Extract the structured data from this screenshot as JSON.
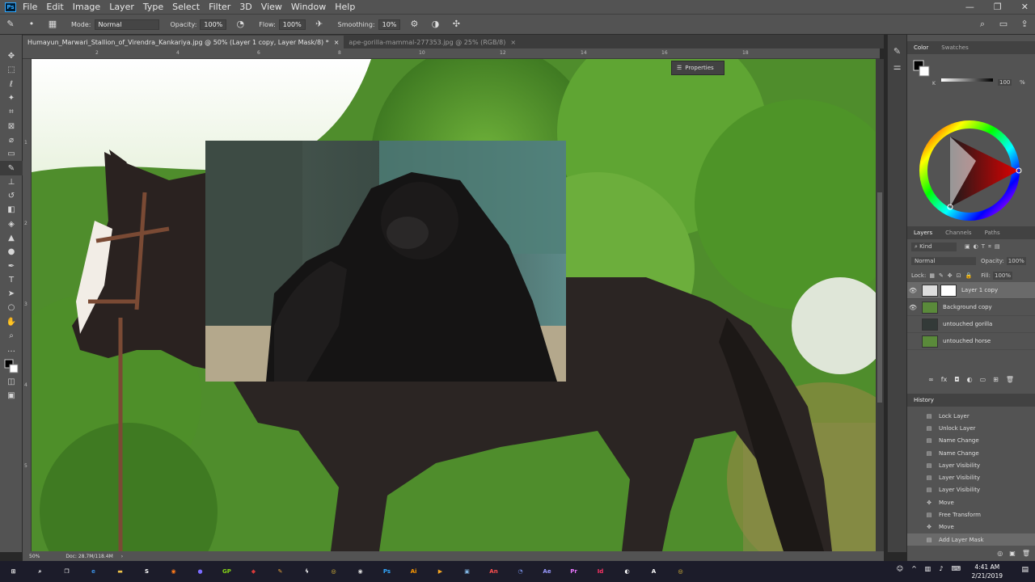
{
  "menubar": {
    "logo": "Ps",
    "items": [
      "File",
      "Edit",
      "Image",
      "Layer",
      "Type",
      "Select",
      "Filter",
      "3D",
      "View",
      "Window",
      "Help"
    ],
    "window_controls": [
      "—",
      "❐",
      "✕"
    ]
  },
  "options": {
    "mode_label": "Mode:",
    "mode_value": "Normal",
    "opacity_label": "Opacity:",
    "opacity_value": "100%",
    "flow_label": "Flow:",
    "flow_value": "100%",
    "smoothing_label": "Smoothing:",
    "smoothing_value": "10%"
  },
  "tabs": [
    {
      "label": "Humayun_Marwari_Stallion_of_Virendra_Kankariya.jpg @ 50% (Layer 1 copy, Layer Mask/8) *",
      "close": "×"
    },
    {
      "label": "ape-gorilla-mammal-277353.jpg @ 25% (RGB/8)",
      "close": "×"
    }
  ],
  "ruler": {
    "h": [
      "0",
      "2",
      "4",
      "6",
      "8",
      "10",
      "12",
      "14",
      "16",
      "18"
    ],
    "v": [
      "0",
      "1",
      "2",
      "3",
      "4",
      "5"
    ]
  },
  "properties": {
    "label": "Properties"
  },
  "status": {
    "zoom": "50%",
    "doc": "Doc: 28.7M/118.4M"
  },
  "color_panel": {
    "tabs": [
      "Color",
      "Swatches"
    ],
    "k_label": "K",
    "k_value": "100",
    "pct": "%"
  },
  "layers_panel": {
    "tabs": [
      "Layers",
      "Channels",
      "Paths"
    ],
    "filter": "Kind",
    "blend": "Normal",
    "opacity_label": "Opacity:",
    "opacity_value": "100%",
    "lock_label": "Lock:",
    "fill_label": "Fill:",
    "fill_value": "100%",
    "layers": [
      {
        "name": "Layer 1 copy",
        "visible": true,
        "selected": true
      },
      {
        "name": "Background copy",
        "visible": true,
        "selected": false
      },
      {
        "name": "untouched gorilla",
        "visible": false,
        "selected": false
      },
      {
        "name": "untouched horse",
        "visible": false,
        "selected": false
      }
    ],
    "footer_icons": [
      "link-icon",
      "fx-icon",
      "mask-icon",
      "adjustment-icon",
      "group-icon",
      "new-layer-icon",
      "trash-icon"
    ]
  },
  "history_panel": {
    "title": "History",
    "items": [
      {
        "label": "Lock Layer",
        "icon": "doc"
      },
      {
        "label": "Unlock Layer",
        "icon": "doc"
      },
      {
        "label": "Name Change",
        "icon": "doc"
      },
      {
        "label": "Name Change",
        "icon": "doc"
      },
      {
        "label": "Layer Visibility",
        "icon": "doc"
      },
      {
        "label": "Layer Visibility",
        "icon": "doc"
      },
      {
        "label": "Layer Visibility",
        "icon": "doc"
      },
      {
        "label": "Move",
        "icon": "move"
      },
      {
        "label": "Free Transform",
        "icon": "doc"
      },
      {
        "label": "Move",
        "icon": "move"
      },
      {
        "label": "Add Layer Mask",
        "icon": "doc",
        "selected": true
      }
    ]
  },
  "taskbar": {
    "clock_time": "4:41 AM",
    "clock_date": "2/21/2019",
    "apps": [
      {
        "name": "start",
        "label": "⊞",
        "color": "#ffffff"
      },
      {
        "name": "search",
        "label": "⌕",
        "color": "#ffffff"
      },
      {
        "name": "task-view",
        "label": "❐",
        "color": "#ffffff"
      },
      {
        "name": "edge",
        "label": "e",
        "color": "#3b8ee0"
      },
      {
        "name": "explorer",
        "label": "▬",
        "color": "#f0c34a"
      },
      {
        "name": "app-s",
        "label": "S",
        "color": "#ffffff"
      },
      {
        "name": "firefox",
        "label": "◉",
        "color": "#ff7a1a"
      },
      {
        "name": "app-balloon",
        "label": "●",
        "color": "#7b6cff"
      },
      {
        "name": "app-g",
        "label": "GP",
        "color": "#84d417"
      },
      {
        "name": "app-red",
        "label": "◆",
        "color": "#d93a3a"
      },
      {
        "name": "app-feather",
        "label": "✎",
        "color": "#e8a33a"
      },
      {
        "name": "app-dark",
        "label": "ϟ",
        "color": "#ffffff"
      },
      {
        "name": "chrome",
        "label": "◎",
        "color": "#e8c23a"
      },
      {
        "name": "obs",
        "label": "◉",
        "color": "#dddddd"
      },
      {
        "name": "photoshop",
        "label": "Ps",
        "color": "#31a8ff"
      },
      {
        "name": "illustrator",
        "label": "Ai",
        "color": "#ff9a00"
      },
      {
        "name": "media",
        "label": "▶",
        "color": "#f5a623"
      },
      {
        "name": "monitor",
        "label": "▣",
        "color": "#7fb3e0"
      },
      {
        "name": "animate",
        "label": "An",
        "color": "#ff4f4f"
      },
      {
        "name": "discord",
        "label": "◔",
        "color": "#7289da"
      },
      {
        "name": "after-effects",
        "label": "Ae",
        "color": "#9999ff"
      },
      {
        "name": "premiere",
        "label": "Pr",
        "color": "#ea77ff"
      },
      {
        "name": "indesign",
        "label": "Id",
        "color": "#ff3366"
      },
      {
        "name": "app-circle",
        "label": "◐",
        "color": "#ffffff"
      },
      {
        "name": "acrobat",
        "label": "A",
        "color": "#ffffff"
      },
      {
        "name": "chrome2",
        "label": "◎",
        "color": "#e8c23a"
      }
    ]
  }
}
